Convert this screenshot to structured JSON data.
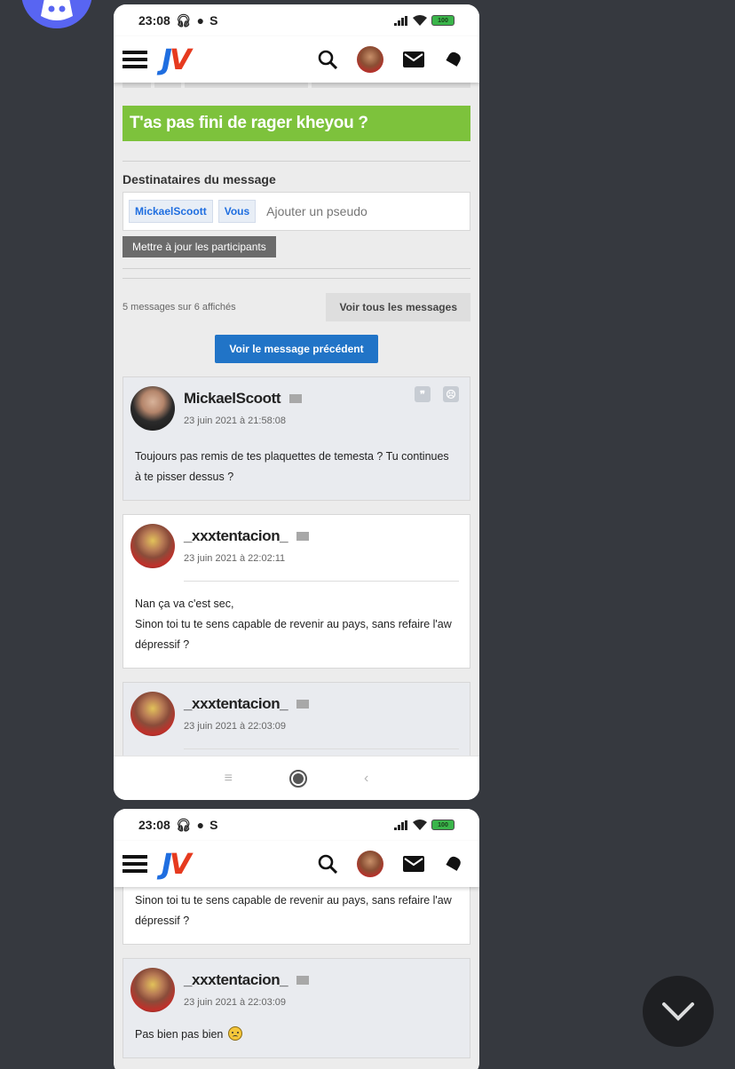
{
  "colors": {
    "discord_bg": "#36393f",
    "discord_blurple": "#5865f2",
    "jv_blue": "#1f6ee0",
    "jv_red": "#e63a1f",
    "topic_green": "#7dc23c",
    "prev_button_blue": "#2174c7"
  },
  "screens": [
    {
      "status": {
        "time": "23:08",
        "extra_icon_letter": "S",
        "battery": "100"
      },
      "navbar": {
        "logo_j": "J",
        "logo_v": "V"
      },
      "topic_title": "T'as pas fini de rager kheyou ?",
      "recipients": {
        "label": "Destinataires du message",
        "tags": [
          "MickaelScoott",
          "Vous"
        ],
        "input_placeholder": "Ajouter un pseudo",
        "update_button": "Mettre à jour les participants"
      },
      "messages_count": "5 messages sur 6 affichés",
      "see_all_button": "Voir tous les messages",
      "previous_button": "Voir le message précédent",
      "posts": [
        {
          "author": "MickaelScoott",
          "date": "23 juin 2021 à 21:58:08",
          "body": [
            "Toujours pas remis de tes plaquettes de temesta ? Tu continues",
            "à te pisser dessus ?"
          ]
        },
        {
          "author": "_xxxtentacion_",
          "date": "23 juin 2021 à 22:02:11",
          "body": [
            "Nan ça va c'est sec,",
            "Sinon toi tu te sens capable de revenir au pays, sans refaire l'aw",
            "dépressif ?"
          ]
        },
        {
          "author": "_xxxtentacion_",
          "date": "23 juin 2021 à 22:03:09"
        }
      ]
    },
    {
      "status": {
        "time": "23:08",
        "extra_icon_letter": "S",
        "battery": "100"
      },
      "navbar": {
        "logo_j": "J",
        "logo_v": "V"
      },
      "continued_body": [
        "Sinon toi tu te sens capable de revenir au pays, sans refaire l'aw",
        "dépressif ?"
      ],
      "posts": [
        {
          "author": "_xxxtentacion_",
          "date": "23 juin 2021 à 22:03:09",
          "body": [
            "Pas bien pas bien"
          ]
        }
      ]
    }
  ]
}
